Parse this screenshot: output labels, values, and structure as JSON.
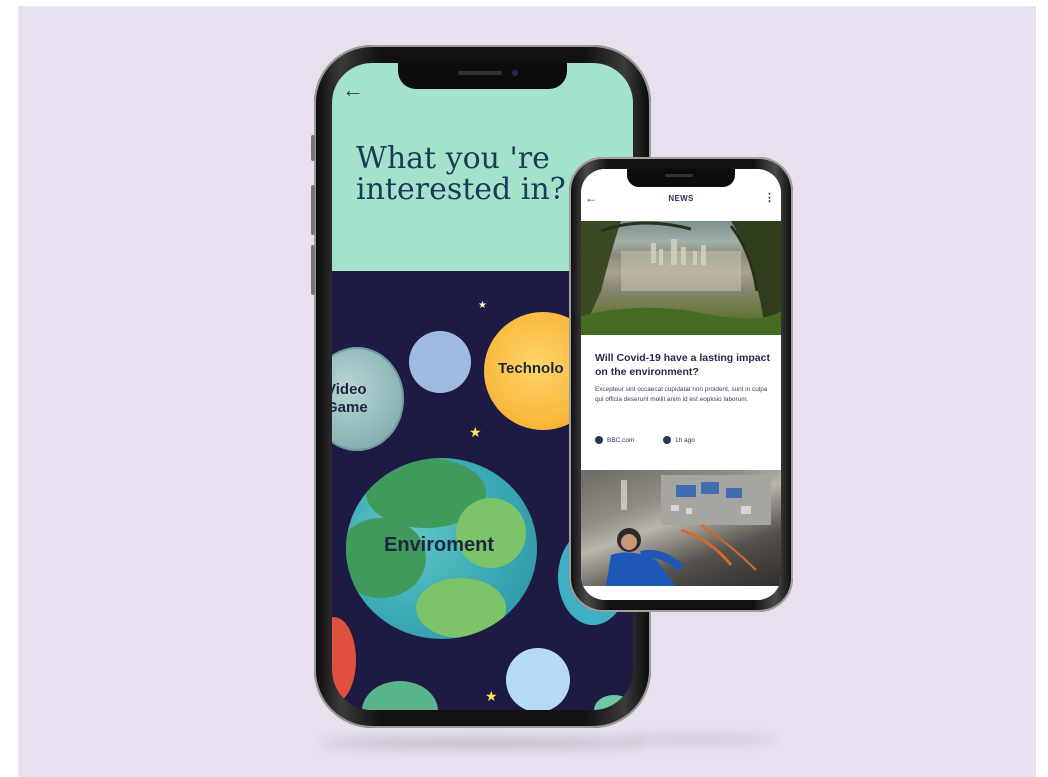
{
  "colors": {
    "background": "#e8e0ef",
    "hero_mint": "#a4e3cb",
    "space_navy": "#1d1b44",
    "title_navy": "#1c3a5a",
    "star_yellow": "#ffe84a"
  },
  "interests_screen": {
    "back_icon": "arrow-left-icon",
    "title": "What you 're interested in?",
    "topics": {
      "video_game": "Video Game",
      "technology": "Technolo",
      "environment": "Enviroment"
    }
  },
  "news_screen": {
    "back_icon": "arrow-left-icon",
    "title": "NEWS",
    "menu_icon": "more-vertical-icon",
    "article": {
      "headline": "Will Covid-19 have a lasting impact on the environment?",
      "excerpt": "Excepteur sint occaecat cupidatat non proident, sunt in culpa qui officia deserunt mollit anim id est eopksio laborum.",
      "source_icon": "globe-icon",
      "source": "BBC.com",
      "time_icon": "clock-icon",
      "time": "1h ago"
    }
  }
}
